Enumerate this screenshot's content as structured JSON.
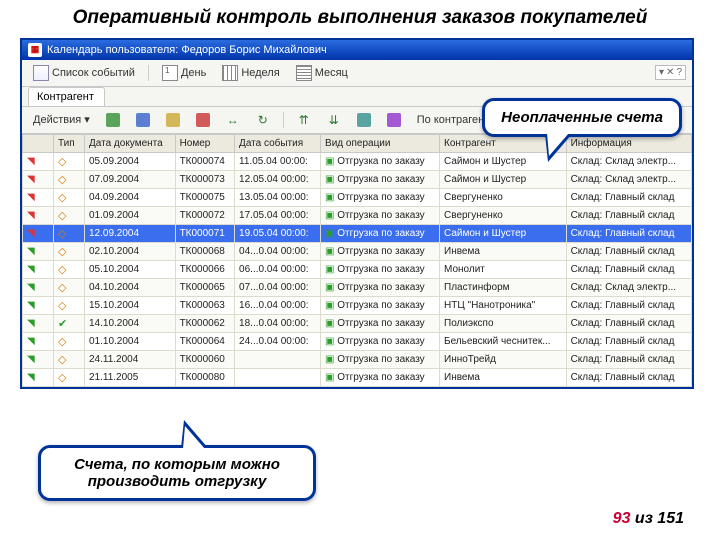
{
  "slide": {
    "title": "Оперативный контроль выполнения заказов покупателей",
    "footer_current": "93",
    "footer_sep": " из ",
    "footer_total": "151"
  },
  "callouts": {
    "top": "Неоплаченные счета",
    "bottom": "Счета, по которым можно производить отгрузку"
  },
  "window": {
    "title": "Календарь пользователя: Федоров Борис Михайлович"
  },
  "toolbar1": {
    "events_list": "Список событий",
    "day": "День",
    "week": "Неделя",
    "month": "Месяц"
  },
  "tab": {
    "label": "Контрагент"
  },
  "toolbar3": {
    "actions": "Действия",
    "by_counterparty": "По контрагенту"
  },
  "headers": {
    "c1": "",
    "c2": "Тип",
    "c3": "Дата документа",
    "c4": "Номер",
    "c5": "Дата события",
    "c6": "Вид операции",
    "c7": "Контрагент",
    "c8": "Информация"
  },
  "rows": [
    {
      "mark": "red",
      "type": "diamond",
      "date": "05.09.2004",
      "num": "ТК000074",
      "event": "11.05.04 00:00:",
      "op": "Отгрузка по заказу",
      "agent": "Саймон и Шустер",
      "info": "Склад: Склад электр..."
    },
    {
      "mark": "red",
      "type": "diamond",
      "date": "07.09.2004",
      "num": "ТК000073",
      "event": "12.05.04 00:00:",
      "op": "Отгрузка по заказу",
      "agent": "Саймон и Шустер",
      "info": "Склад: Склад электр..."
    },
    {
      "mark": "red",
      "type": "diamond",
      "date": "04.09.2004",
      "num": "ТК000075",
      "event": "13.05.04 00:00:",
      "op": "Отгрузка по заказу",
      "agent": "Свергуненко",
      "info": "Склад: Главный склад"
    },
    {
      "mark": "red",
      "type": "diamond",
      "date": "01.09.2004",
      "num": "ТК000072",
      "event": "17.05.04 00:00:",
      "op": "Отгрузка по заказу",
      "agent": "Свергуненко",
      "info": "Склад: Главный склад"
    },
    {
      "mark": "red",
      "type": "diamond",
      "date": "12.09.2004",
      "num": "ТК000071",
      "event": "19.05.04 00:00:",
      "op": "Отгрузка по заказу",
      "agent": "Саймон и Шустер",
      "info": "Склад: Главный склад",
      "selected": true
    },
    {
      "mark": "green",
      "type": "diamond",
      "date": "02.10.2004",
      "num": "ТК000068",
      "event": "04...0.04 00:00:",
      "op": "Отгрузка по заказу",
      "agent": "Инвема",
      "info": "Склад: Главный склад"
    },
    {
      "mark": "green",
      "type": "diamond",
      "date": "05.10.2004",
      "num": "ТК000066",
      "event": "06...0.04 00:00:",
      "op": "Отгрузка по заказу",
      "agent": "Монолит",
      "info": "Склад: Главный склад"
    },
    {
      "mark": "green",
      "type": "diamond",
      "date": "04.10.2004",
      "num": "ТК000065",
      "event": "07...0.04 00:00:",
      "op": "Отгрузка по заказу",
      "agent": "Пластинформ",
      "info": "Склад: Склад электр..."
    },
    {
      "mark": "green",
      "type": "diamond",
      "date": "15.10.2004",
      "num": "ТК000063",
      "event": "16...0.04 00:00:",
      "op": "Отгрузка по заказу",
      "agent": "НТЦ \"Нанотроника\"",
      "info": "Склад: Главный склад"
    },
    {
      "mark": "green",
      "type": "check",
      "date": "14.10.2004",
      "num": "ТК000062",
      "event": "18...0.04 00:00:",
      "op": "Отгрузка по заказу",
      "agent": "Полиэкспо",
      "info": "Склад: Главный склад"
    },
    {
      "mark": "green",
      "type": "diamond",
      "date": "01.10.2004",
      "num": "ТК000064",
      "event": "24...0.04 00:00:",
      "op": "Отгрузка по заказу",
      "agent": "Бельевский чеснитек...",
      "info": "Склад: Главный склад"
    },
    {
      "mark": "green",
      "type": "diamond",
      "date": "24.11.2004",
      "num": "ТК000060",
      "event": "",
      "op": "Отгрузка по заказу",
      "agent": "ИнноТрейд",
      "info": "Склад: Главный склад"
    },
    {
      "mark": "green",
      "type": "diamond",
      "date": "21.11.2005",
      "num": "ТК000080",
      "event": "",
      "op": "Отгрузка по заказу",
      "agent": "Инвема",
      "info": "Склад: Главный склад"
    }
  ]
}
